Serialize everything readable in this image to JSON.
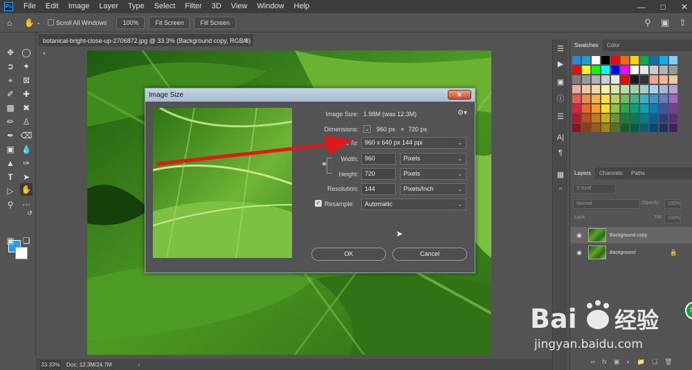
{
  "menu": {
    "items": [
      "File",
      "Edit",
      "Image",
      "Layer",
      "Type",
      "Select",
      "Filter",
      "3D",
      "View",
      "Window",
      "Help"
    ]
  },
  "options_bar": {
    "scroll_all_label": "Scroll All Windows",
    "zoom_button": "100%",
    "fit_screen_button": "Fit Screen",
    "fill_screen_button": "Fill Screen"
  },
  "document_tab": {
    "title": "botanical-bright-close-up-2706872.jpg @ 33.3% (Background copy, RGB/8) *"
  },
  "status_bar": {
    "zoom": "33.33%",
    "doc_info": "Doc: 12.3M/24.7M"
  },
  "swatches_panel": {
    "tabs": [
      "Swatches",
      "Color"
    ],
    "colors": [
      "#1a8fe0",
      "#0fa3d9",
      "#ffffff",
      "#000000",
      "#ff0000",
      "#ff6a00",
      "#ffd400",
      "#00b050",
      "#0070c0",
      "#00b0f0",
      "#7fd0f5",
      "#ff0000",
      "#ffff00",
      "#00ff00",
      "#00ffff",
      "#0000ff",
      "#ff00ff",
      "#ffffff",
      "#e6e6e6",
      "#cccccc",
      "#b3b3b3",
      "#999999",
      "#808080",
      "#999999",
      "#b3b3b3",
      "#cccccc",
      "#e6e6e6",
      "#ff0000",
      "#1a1a1a",
      "#333333",
      "#f5a08c",
      "#f7b38f",
      "#f5c9a0",
      "#f6a69a",
      "#f7c7a0",
      "#fadb9f",
      "#fff2a3",
      "#d8eaa1",
      "#b9dca1",
      "#9fd1a1",
      "#9fd3c9",
      "#a0d4ec",
      "#a1b9e0",
      "#b3a1d6",
      "#e65c50",
      "#ee8a4a",
      "#f6b448",
      "#fbe14a",
      "#b7d45a",
      "#6cbf5e",
      "#3fb28c",
      "#39b3c6",
      "#3c96d2",
      "#6a7cc3",
      "#9a6cbf",
      "#e0203a",
      "#f0651f",
      "#f5a01e",
      "#fddc1f",
      "#8cc341",
      "#2aa84a",
      "#00a57a",
      "#00a5c0",
      "#0080c6",
      "#3b56a6",
      "#7a3e99",
      "#b4162a",
      "#c04e16",
      "#c77a14",
      "#cbb015",
      "#6b9a30",
      "#1b8035",
      "#007d5c",
      "#007f94",
      "#00609a",
      "#2b3f80",
      "#5c2d77",
      "#8c1220",
      "#943c10",
      "#995f10",
      "#9e8810",
      "#507524",
      "#135f28",
      "#005e46",
      "#005f70",
      "#004875",
      "#1f2f60",
      "#44205a"
    ]
  },
  "layers_panel": {
    "tabs": [
      "Layers",
      "Channels",
      "Paths"
    ],
    "kind_label": "Kind",
    "blend_mode": "Normal",
    "opacity_label": "Opacity:",
    "opacity_value": "100%",
    "lock_label": "Lock:",
    "fill_label": "Fill:",
    "fill_value": "100%",
    "layers": [
      {
        "name": "Background copy",
        "selected": true
      },
      {
        "name": "Background",
        "selected": false,
        "locked": true
      }
    ]
  },
  "dialog": {
    "title": "Image Size",
    "image_size_label": "Image Size:",
    "image_size_value": "1.98M (was 12.3M)",
    "dimensions_label": "Dimensions:",
    "dimensions_width": "960 px",
    "dimensions_sep": "×",
    "dimensions_height": "720 px",
    "fit_to_label": "Fit To:",
    "fit_to_value": "960 x 640 px 144 ppi",
    "width_label": "Width:",
    "width_value": "960",
    "width_unit": "Pixels",
    "height_label": "Height:",
    "height_value": "720",
    "height_unit": "Pixels",
    "resolution_label": "Resolution:",
    "resolution_value": "144",
    "resolution_unit": "Pixels/Inch",
    "resample_label": "Resample:",
    "resample_value": "Automatic",
    "ok_button": "OK",
    "cancel_button": "Cancel"
  },
  "watermark": {
    "site": "jingyan.baidu.com",
    "badge": "78"
  },
  "colors": {
    "arrow": "#e01818",
    "accent_blue": "#1fa0e8"
  }
}
